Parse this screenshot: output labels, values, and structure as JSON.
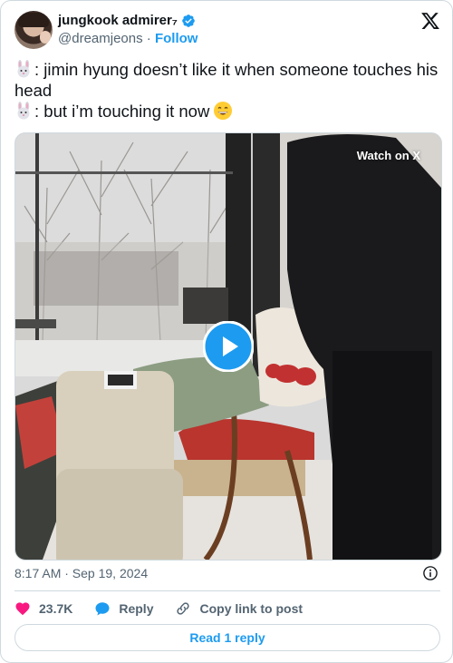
{
  "author": {
    "display_name": "jungkook admirer₇",
    "handle": "@dreamjeons",
    "separator": "·",
    "follow_label": "Follow"
  },
  "tweet": {
    "line1": ": jimin hyung doesn’t like it when someone touches his head",
    "line2": ": but i’m touching it now"
  },
  "media": {
    "watch_label": "Watch on X"
  },
  "meta": {
    "timestamp": "8:17 AM · Sep 19, 2024"
  },
  "actions": {
    "likes": "23.7K",
    "reply_label": "Reply",
    "copy_label": "Copy link to post"
  },
  "read_reply_label": "Read 1 reply",
  "colors": {
    "accent": "#1d9bf0",
    "like": "#f91880",
    "secondary_text": "#536471",
    "border": "#cfd9de"
  },
  "icons": [
    "x-logo-icon",
    "verified-badge-icon",
    "rabbit-emoji-icon",
    "grin-emoji-icon",
    "play-icon",
    "info-icon",
    "heart-icon",
    "reply-bubble-icon",
    "link-icon"
  ]
}
